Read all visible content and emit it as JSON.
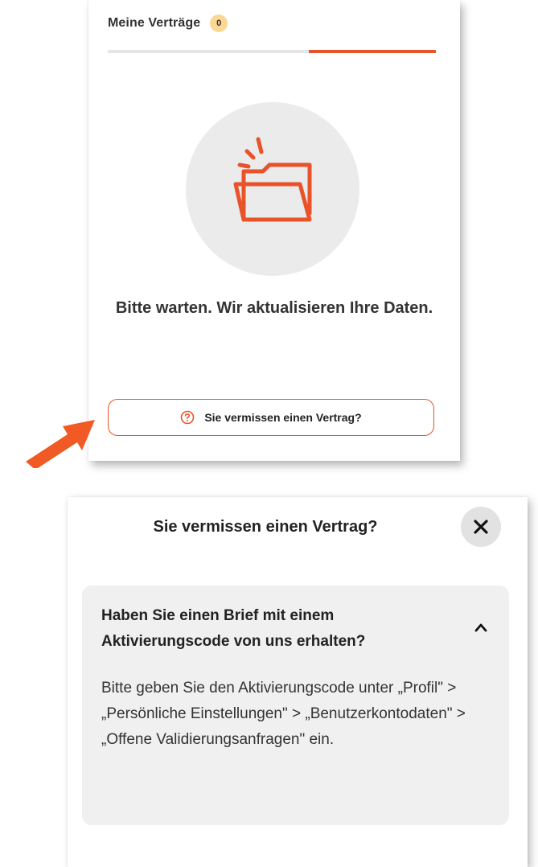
{
  "contracts": {
    "tab_title": "Meine Verträge",
    "badge_count": "0",
    "status_message": "Bitte warten. Wir aktualisieren Ihre Daten.",
    "missing_button_label": "Sie vermissen einen Vertrag?",
    "illustration_icon": "folder-icon",
    "accent_color": "#e8532a",
    "badge_color": "#fbd893"
  },
  "sheet": {
    "title": "Sie vermissen einen Vertrag?",
    "close_icon": "close-icon",
    "faq": {
      "question": "Haben Sie einen Brief mit einem Aktivierungscode von uns erhalten?",
      "answer": "Bitte geben Sie den Aktivierungscode unter „Profil\" > „Persönliche Einstellungen\" > „Benutzerkontodaten\" > „Offene Validierungsanfragen\" ein.",
      "expanded": true
    }
  }
}
